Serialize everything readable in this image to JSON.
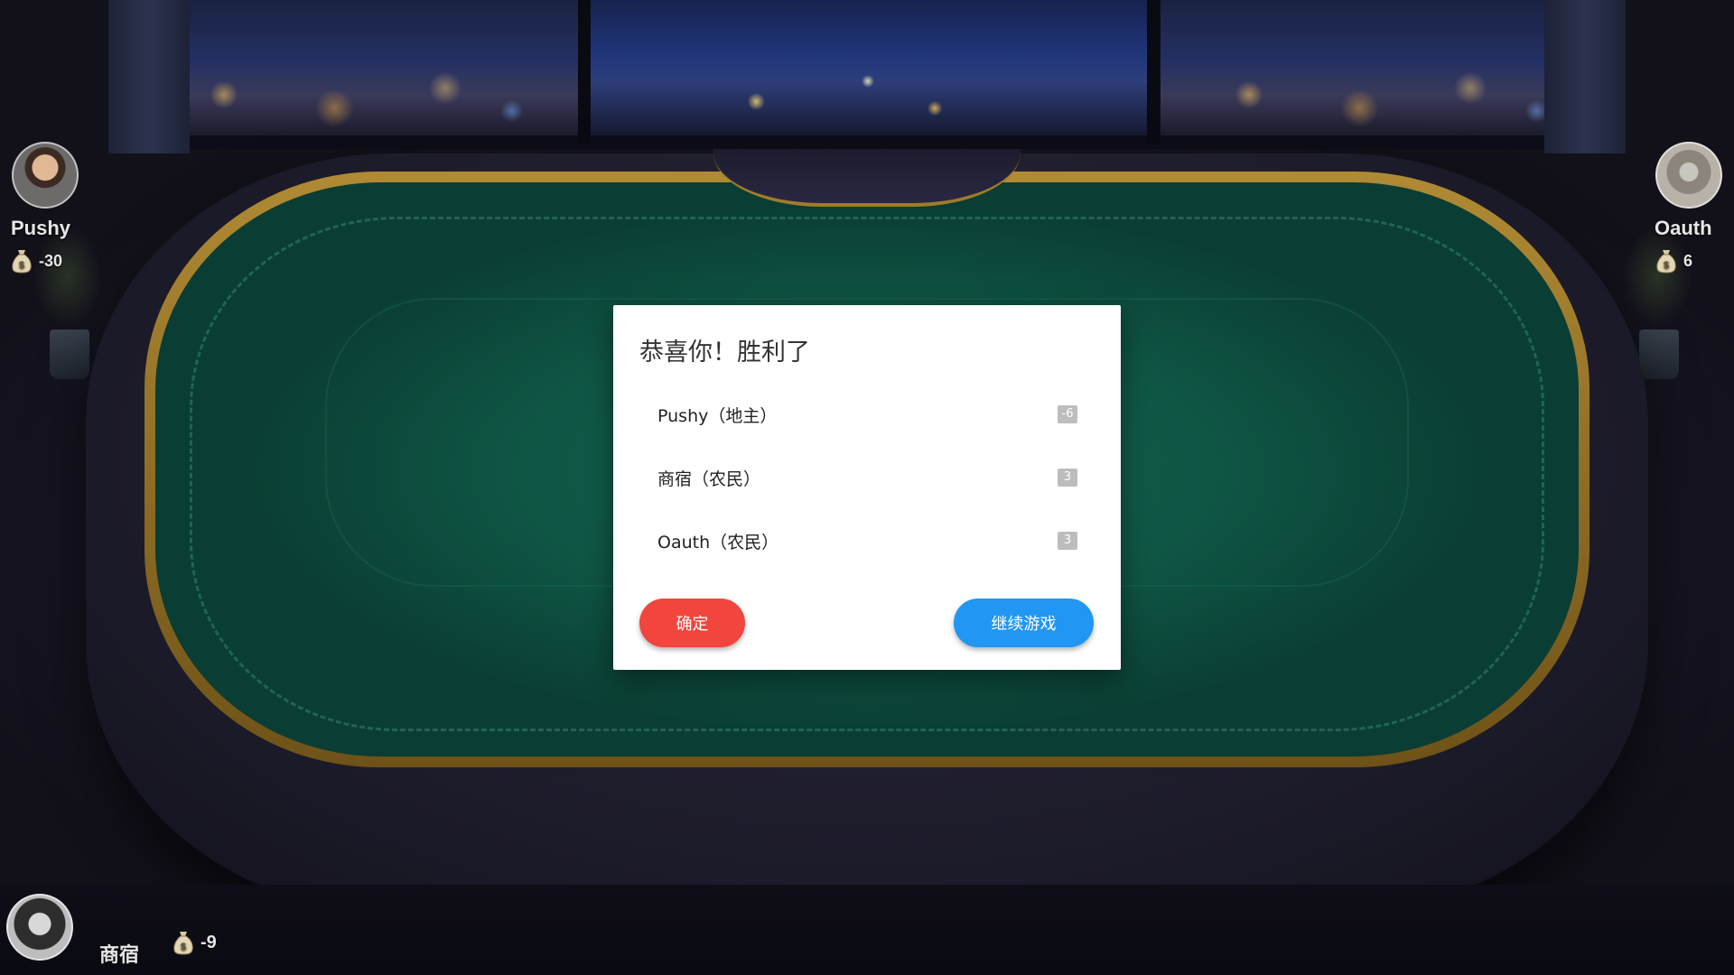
{
  "players": {
    "left": {
      "name": "Pushy",
      "coins": "-30"
    },
    "right": {
      "name": "Oauth",
      "coins": "6"
    },
    "self": {
      "name": "商宿",
      "coins": "-9"
    }
  },
  "dialog": {
    "title": "恭喜你！胜利了",
    "results": [
      {
        "name": "Pushy（地主）",
        "score": "-6"
      },
      {
        "name": "商宿（农民）",
        "score": "3"
      },
      {
        "name": "Oauth（农民）",
        "score": "3"
      }
    ],
    "confirm_label": "确定",
    "continue_label": "继续游戏"
  },
  "colors": {
    "felt": "#0f5645",
    "confirm_button": "#f2453d",
    "continue_button": "#2196f3",
    "score_badge": "#bdbdbd"
  },
  "icons": {
    "coin": "money-bag-icon"
  }
}
